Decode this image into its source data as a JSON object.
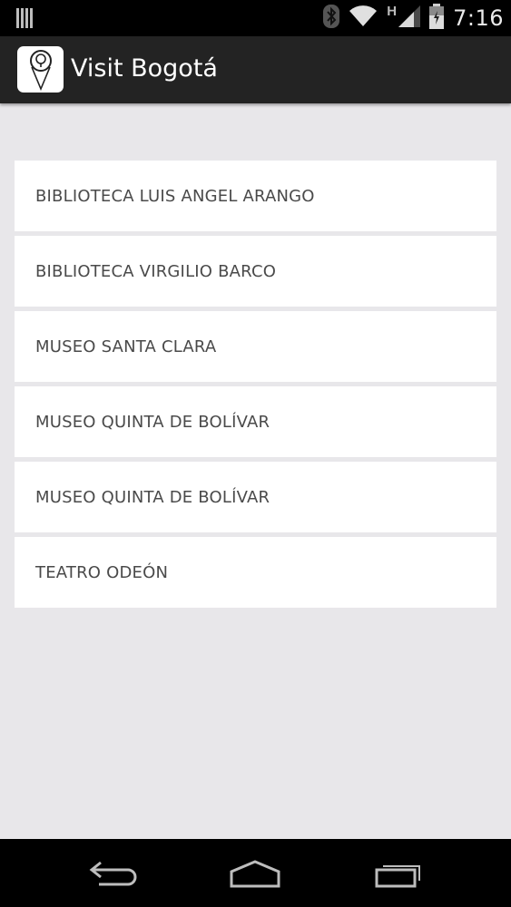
{
  "status_bar": {
    "time": "7:16",
    "network_type": "H",
    "icons": [
      "notification-icon",
      "bluetooth-icon",
      "wifi-icon",
      "signal-icon",
      "battery-icon"
    ]
  },
  "app_bar": {
    "title": "Visit Bogotá",
    "icon": "map-pin-icon"
  },
  "places": [
    {
      "label": "BIBLIOTECA LUIS ANGEL ARANGO"
    },
    {
      "label": "BIBLIOTECA VIRGILIO BARCO"
    },
    {
      "label": "MUSEO SANTA CLARA"
    },
    {
      "label": "MUSEO QUINTA DE BOLÍVAR"
    },
    {
      "label": "MUSEO QUINTA DE BOLÍVAR"
    },
    {
      "label": "TEATRO ODEÓN"
    }
  ],
  "nav_bar": {
    "buttons": [
      "back-icon",
      "home-icon",
      "recent-apps-icon"
    ]
  },
  "colors": {
    "status_bar": "#000000",
    "app_bar": "#232323",
    "background": "#e8e7ea",
    "list_item": "#ffffff",
    "list_text": "#4a4a4a"
  }
}
